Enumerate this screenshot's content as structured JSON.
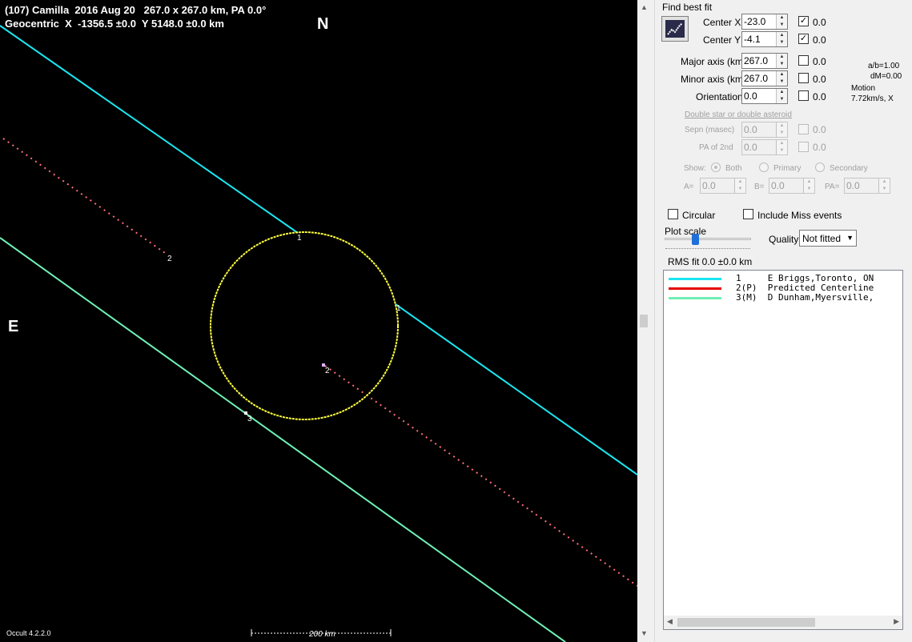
{
  "plot": {
    "header_line1": "(107) Camilla  2016 Aug 20   267.0 x 267.0 km, PA 0.0°",
    "header_line2": "Geocentric  X  -1356.5 ±0.0  Y 5148.0 ±0.0 km",
    "north_label": "N",
    "east_label": "E",
    "chord_labels": [
      "1",
      "1",
      "2",
      "2",
      "3"
    ],
    "scale_label": "200 km",
    "version": "Occult 4.2.2.0",
    "colors": {
      "background": "#000000",
      "ellipse": "#ffff3c",
      "chord1": "#19e6f0",
      "chord3": "#6ef0b4",
      "predicted": "#ff6e78"
    }
  },
  "panel": {
    "find_best_fit": "Find best fit",
    "center_x": {
      "label": "Center X",
      "value": "-23.0",
      "checked": true,
      "fit": "0.0"
    },
    "center_y": {
      "label": "Center Y",
      "value": "-4.1",
      "checked": true,
      "fit": "0.0"
    },
    "major_axis": {
      "label": "Major axis (km)",
      "value": "267.0",
      "checked": false,
      "fit": "0.0"
    },
    "minor_axis": {
      "label": "Minor axis (km)",
      "value": "267.0",
      "checked": false,
      "fit": "0.0"
    },
    "orientation": {
      "label": "Orientation",
      "value": "0.0",
      "checked": false,
      "fit": "0.0"
    },
    "ratio": "a/b=1.00",
    "dm": "dM=0.00",
    "motion_label": "Motion",
    "motion_value": "7.72km/s, X",
    "double_star": "Double star  or  double asteroid",
    "sepn": {
      "label": "Sepn (masec)",
      "value": "0.0",
      "fit": "0.0"
    },
    "pa_2nd": {
      "label": "PA of 2nd",
      "value": "0.0",
      "fit": "0.0"
    },
    "show_label": "Show:",
    "show_options": [
      "Both",
      "Primary",
      "Secondary"
    ],
    "a_label": "A=",
    "a_value": "0.0",
    "b_label": "B=",
    "b_value": "0.0",
    "pa_label": "PA=",
    "pa_value": "0.0",
    "circular": "Circular",
    "include_miss": "Include Miss events",
    "plot_scale": "Plot scale",
    "quality_label": "Quality",
    "quality_value": "Not fitted",
    "rms": "RMS fit  0.0 ±0.0 km",
    "legend": [
      {
        "id": "1   ",
        "name": "E Briggs,Toronto, ON",
        "color": "#19e6f0"
      },
      {
        "id": "2(P)",
        "name": "Predicted Centerline",
        "color": "#e60000"
      },
      {
        "id": "3(M)",
        "name": "D Dunham,Myersville,",
        "color": "#6ef0b4"
      }
    ]
  }
}
